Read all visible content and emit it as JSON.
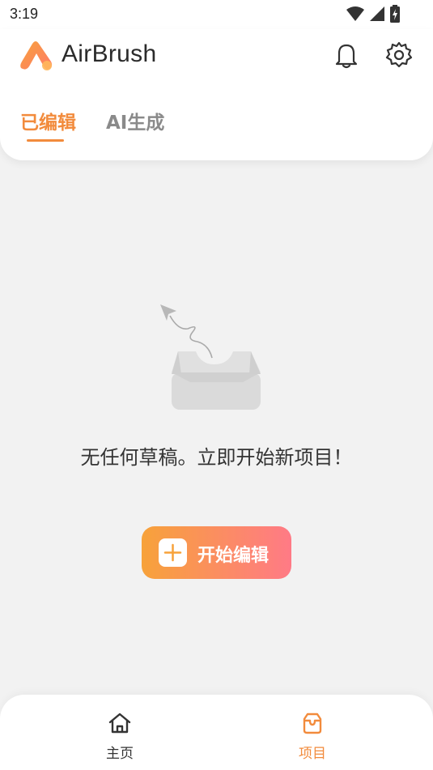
{
  "status_bar": {
    "time": "3:19",
    "icons": [
      "wifi-icon",
      "signal-icon",
      "battery-icon"
    ]
  },
  "header": {
    "app_name": "AirBrush",
    "logo": "airbrush-logo",
    "actions": [
      "bell-icon",
      "gear-icon"
    ]
  },
  "tabs": [
    {
      "label": "已编辑",
      "active": true
    },
    {
      "label": "AI生成",
      "active": false
    }
  ],
  "empty_state": {
    "illustration": "empty-box-paper-plane",
    "message": "无任何草稿。立即开始新项目！"
  },
  "start_button": {
    "label": "开始编辑",
    "icon": "plus-icon"
  },
  "bottom_nav": [
    {
      "label": "主页",
      "icon": "home-icon",
      "active": false
    },
    {
      "label": "项目",
      "icon": "project-box-icon",
      "active": true
    }
  ],
  "colors": {
    "accent": "#f28b3c",
    "gradient_start": "#f7a23a",
    "gradient_end": "#ff7a86",
    "background": "#f2f2f2"
  }
}
